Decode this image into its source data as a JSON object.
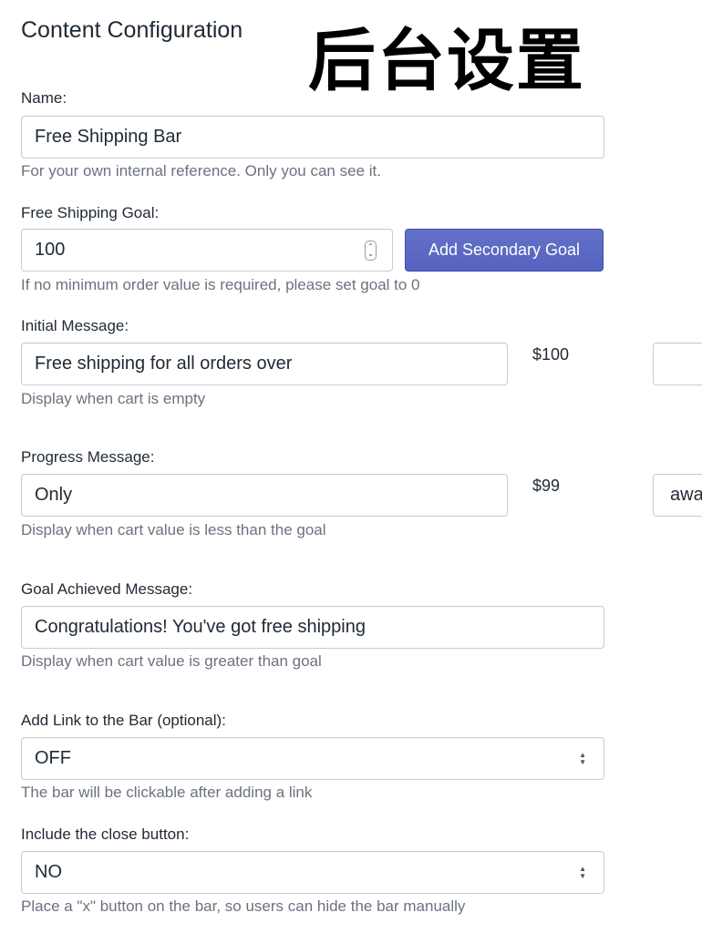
{
  "page": {
    "title": "Content Configuration",
    "overlay_title": "后台设置"
  },
  "name": {
    "label": "Name:",
    "value": "Free Shipping Bar",
    "help": "For your own internal reference. Only you can see it."
  },
  "goal": {
    "label": "Free Shipping Goal:",
    "value": "100",
    "add_secondary_label": "Add Secondary Goal",
    "help": "If no minimum order value is required, please set goal to 0"
  },
  "initial_message": {
    "label": "Initial Message:",
    "value": "Free shipping for all orders over",
    "amount": "$100",
    "suffix_value": "",
    "help": "Display when cart is empty"
  },
  "progress_message": {
    "label": "Progress Message:",
    "value": "Only",
    "amount": "$99",
    "suffix_value": "awa",
    "help": "Display when cart value is less than the goal"
  },
  "achieved_message": {
    "label": "Goal Achieved Message:",
    "value": "Congratulations! You've got free shipping",
    "help": "Display when cart value is greater than goal"
  },
  "link": {
    "label": "Add Link to the Bar (optional):",
    "value": "OFF",
    "help": "The bar will be clickable after adding a link"
  },
  "close_button": {
    "label": "Include the close button:",
    "value": "NO",
    "help": "Place a \"x\" button on the bar, so users can hide the bar manually"
  },
  "colors": {
    "primary_button": "#5c6ac4",
    "border": "#c4cdd5",
    "help_text": "#6b7280"
  },
  "icons": {
    "stepper": "stepper-icon",
    "select": "select-arrows-icon"
  }
}
